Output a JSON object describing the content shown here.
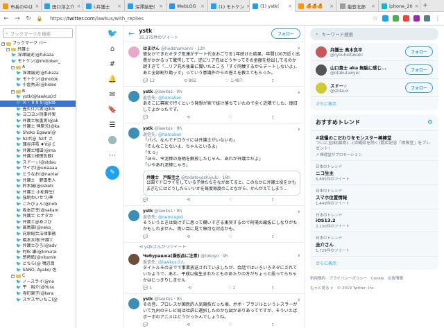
{
  "browser": {
    "tabs": [
      {
        "label": "市長の中は",
        "color": "#ff9800"
      },
      {
        "label": "田口淳之介",
        "color": "#1da1f2"
      },
      {
        "label": "L弁護士 ",
        "color": "#1da1f2"
      },
      {
        "label": "深澤諭史(",
        "color": "#1da1f2"
      },
      {
        "label": "WebLOG ",
        "color": "#2196f3"
      },
      {
        "label": "(1) モトケン",
        "color": "#1da1f2"
      },
      {
        "label": "(1) ystk(",
        "color": "#1da1f2",
        "active": true
      },
      {
        "label": "🍊🍊🍊",
        "color": "#ff9800"
      },
      {
        "label": "能登北部",
        "color": "#9e9e9e"
      },
      {
        "label": "iphone_20",
        "color": "#00bcd4"
      }
    ],
    "url_host": "twitter.com",
    "url_path": "/lawkus/with_replies",
    "url_prefix": "https://"
  },
  "bookmarks": {
    "search_placeholder": "ブックマークを検索",
    "items": [
      {
        "label": "ブックマーク バー",
        "type": "folder",
        "indent": 0,
        "box": "−"
      },
      {
        "label": "弁護士",
        "type": "folder",
        "indent": 1,
        "box": "−"
      },
      {
        "label": "深澤諭史(@fukaza",
        "type": "tw",
        "indent": 2
      },
      {
        "label": "モトケン(@motoken_",
        "type": "tw",
        "indent": 2
      },
      {
        "label": "A",
        "type": "folder",
        "indent": 2,
        "box": "−"
      },
      {
        "label": "深澤諭史(@fukaza",
        "type": "tw",
        "indent": 3
      },
      {
        "label": "モトケン(@motok",
        "type": "tw",
        "indent": 3
      },
      {
        "label": "小倉秀夫(@hideo",
        "type": "tw",
        "indent": 3
      },
      {
        "label": "B",
        "type": "folder",
        "indent": 2,
        "box": "−"
      },
      {
        "label": "ystk(@lawkus)さ",
        "type": "tw",
        "indent": 3
      },
      {
        "label": "Ｋ・９９９(@kI9",
        "type": "tw",
        "indent": 3,
        "selected": true
      },
      {
        "label": "畳久仕六男(@kik",
        "type": "tw",
        "indent": 3
      },
      {
        "label": "ヨコヨン刑事弁実",
        "type": "tw",
        "indent": 3
      },
      {
        "label": "弁護士秋重実(@ak",
        "type": "tw",
        "indent": 3
      },
      {
        "label": "弁護士 神原元(@ka",
        "type": "tw",
        "indent": 3
      },
      {
        "label": "Shoko Egawa(@",
        "type": "tw",
        "indent": 3
      },
      {
        "label": "hzrf(@_hzrf_さ",
        "type": "tw",
        "indent": 3
      },
      {
        "label": "蒲谷洋祐 ♦Yoji C",
        "type": "tw",
        "indent": 3
      },
      {
        "label": "弁護士増田(@ma",
        "type": "tw",
        "indent": 3
      },
      {
        "label": "弁護士様田哲朗(",
        "type": "tw",
        "indent": 3
      },
      {
        "label": "スドー☆(@stdau",
        "type": "tw",
        "indent": 3
      },
      {
        "label": "サイボ(@uwaaaa",
        "type": "tw",
        "indent": 3
      },
      {
        "label": "とりなお(@naotar",
        "type": "tw",
        "indent": 3
      },
      {
        "label": "弁護士　野田隼人",
        "type": "tw",
        "indent": 3
      },
      {
        "label": "鈴木誠(@ssketc",
        "type": "tw",
        "indent": 3
      },
      {
        "label": "弁護士 小松幹生(",
        "type": "tw",
        "indent": 3
      },
      {
        "label": "強制わいせつ/準",
        "type": "tw",
        "indent": 3
      },
      {
        "label": "ごたびょん(@nob",
        "type": "tw",
        "indent": 3
      },
      {
        "label": "坂本正幸(@sakam",
        "type": "tw",
        "indent": 3
      },
      {
        "label": "弁護士 ヒナタカ",
        "type": "tw",
        "indent": 3
      },
      {
        "label": "弁護士@あさひ",
        "type": "tw",
        "indent": 3
      },
      {
        "label": "高島章(@neko_",
        "type": "tw",
        "indent": 3
      },
      {
        "label": "向原総合法律事務",
        "type": "tw",
        "indent": 3
      },
      {
        "label": "橋本太地(弁護士",
        "type": "tw",
        "indent": 3
      },
      {
        "label": "弁護士ひろ(@adv",
        "type": "tw",
        "indent": 3
      },
      {
        "label": "村松 謙(@kmurai",
        "type": "tw",
        "indent": 3
      },
      {
        "label": "感熱紙(@vitamin",
        "type": "tw",
        "indent": 3
      },
      {
        "label": "どちら(@ 鳴忍目",
        "type": "tw",
        "indent": 3
      },
      {
        "label": "SANO, Ayako/ 佐",
        "type": "tw",
        "indent": 3
      },
      {
        "label": "C",
        "type": "folder",
        "indent": 2,
        "box": "−"
      },
      {
        "label": "ノースライ(@no",
        "type": "tw",
        "indent": 3
      },
      {
        "label": "平　裕介(@Yusu",
        "type": "tw",
        "indent": 3
      },
      {
        "label": "寺町東子(@tera",
        "type": "tw",
        "indent": 3
      },
      {
        "label": "スヤスヤいちご(@",
        "type": "tw",
        "indent": 3
      }
    ]
  },
  "profile": {
    "name": "ystk",
    "tweet_count": "35,375件のツイート",
    "follow_label": "フォロー",
    "back_icon": "arrow-left-icon"
  },
  "tweets": [
    {
      "name": "はまけん",
      "handle": "@hedshamanni",
      "time": "12h",
      "avatar": "#e8a9c9",
      "text": "彼女ができたオタク友達がデート代全おごりを1年続けた結果、年間100万近く出費がかかるって驚愕してて、逆にリア充はどうやってその金額を捻出してるのか謎すぎて「…リア充の後輩に聞いたところ「すぐ同棲するからデートしないよ」、あと全部割り勘ッす」っていう意識外からの答えを教えてもらった。",
      "reply": "12",
      "rt": "882",
      "like": "1,487"
    },
    {
      "name": "ystk",
      "handle": "@lawkus",
      "time": "9h",
      "avatar": "#3a8fb7",
      "reply_to": "@hamaken",
      "reply_label": "返信先:",
      "text": "あそこに幕家で行くという発想が家で抜け落ちていたので全く近隣でした、復旧してよかったです。",
      "reply": "",
      "rt": "",
      "like": ""
    },
    {
      "name": "ystk",
      "handle": "@lawkus",
      "time": "9h",
      "avatar": "#3a8fb7",
      "reply_to": "@hamaken",
      "reply_label": "返信先:",
      "text": "「パパ、なんでドロウイには弁護士がいないの」\n「そんなことないよ、ちゃんといるよ」\n「えっ」\n「ほら、今泥棒の身柄を解放したじゃん、あれが弁護士だよ」\n「いやあれ泥棒じゃろ」",
      "quote": {
        "name": "弁護士　戸館圭之",
        "handle": "@todateyoshiyuki",
        "time": "18h",
        "text": "公園でドロウイをしている子供たちをながめてると、このなかに弁護士役をかもまぎむにはどうしたらいいかを毎度毎度のことながら、かんがえてしまう…"
      },
      "reply": "",
      "rt": "",
      "like": ""
    },
    {
      "name": "ystk",
      "handle": "@lawkus",
      "time": "9h",
      "avatar": "#3a8fb7",
      "reply_to": "@nemcopid",
      "reply_label": "返信先:",
      "text": "そういうときは負けずに思って欄いすぎる東突するので刑場の厳抜にしなりがちかもしれません。鳥い目に見て無可な対応かも。",
      "reply": "",
      "rt": "",
      "like": ""
    },
    {
      "rt_note": "ystkさんがリツイート",
      "name": "Чебурашка(猫仮品に注意)",
      "handle": "@tokoyo",
      "time": "9h",
      "avatar": "#6b4f3a",
      "reply_to": "@lawkusさん",
      "reply_label": "返信先:",
      "text": "タイトルそのまでで事業放送されていましたが、会話ではいろいろネタにされていたようで、あと、平成以後生まれたとものあたりの方がちょっと段ってらちゃかはじっきりしません",
      "reply": "1",
      "rt": "",
      "like": "1"
    },
    {
      "name": "ystk",
      "handle": "@lawkus",
      "time": "9h",
      "avatar": "#3a8fb7",
      "text": "その昔、プロレスが国民的人気競技だった頃、ボボ・ブラジルというレスラーがいて九州のテレビ局は社訳に選択したのかな試がありあってですが、そういえばボーボのアニメはどうだったんでしょうね。",
      "reply": "",
      "rt": "",
      "like": ""
    }
  ],
  "right": {
    "search_placeholder": "キーワード検索",
    "who_to_follow": [
      {
        "name": "弁護士 髙木良平",
        "handle": "@ryouheitakaki",
        "color": "#c55",
        "button": "フォロー"
      },
      {
        "name": "山口貴士 aka 無駄に感じ...",
        "handle": "@otakulawyer",
        "color": "#555",
        "button": "フォロー"
      },
      {
        "name": "スドー☆",
        "handle": "@stdaux",
        "color": "#cc3",
        "button": "フォロー"
      }
    ],
    "more": "さらに表示",
    "trends_title": "おすすめトレンド",
    "promoted": {
      "name": "#我慢のこだわりをモンスター棒檸堂",
      "desc": "ついに全国(離島(…(沖縄県を除く)開店記念「棒檸堂」をプレゼント!",
      "by": "棒檸堂がプロモーション"
    },
    "trends": [
      {
        "ctx": "日本のトレンド",
        "name": "ニコ生主",
        "count": "6,895件のツイート"
      },
      {
        "ctx": "日本のトレンド",
        "name": "スマホ位置情報",
        "count": "1,449件のツイート"
      },
      {
        "ctx": "日本のトレンド",
        "name": "iOS13.2",
        "count": "2,150件のツイート"
      },
      {
        "ctx": "日本のトレンド",
        "name": "圭介さん",
        "count": "1,729件のツイート"
      }
    ],
    "trends_more": "さらに表示",
    "footer1": "利用規約　プライバシーポリシー　Cookie　広告情報",
    "footer2": "もっと見る ∨　© 2019 Twitter, Inc."
  }
}
